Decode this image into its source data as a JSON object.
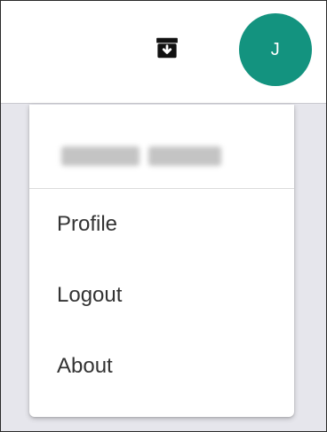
{
  "topbar": {
    "archive_icon": "archive-download-icon",
    "avatar": {
      "initial": "J",
      "color": "#13937f"
    }
  },
  "account_menu": {
    "items": [
      {
        "label": "Profile"
      },
      {
        "label": "Logout"
      },
      {
        "label": "About"
      }
    ]
  },
  "colors": {
    "background": "#e6e6ec",
    "menu_surface": "#ffffff",
    "text": "#333333"
  }
}
